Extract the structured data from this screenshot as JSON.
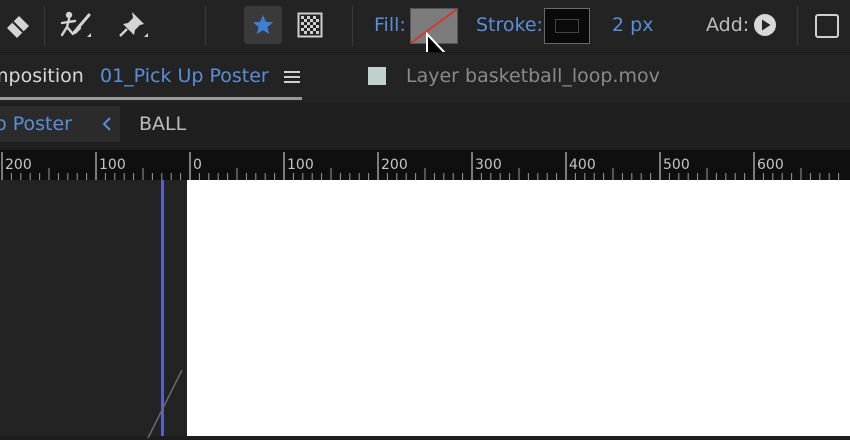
{
  "toolbar": {
    "tools": [
      {
        "name": "eraser"
      },
      {
        "name": "roto-brush"
      },
      {
        "name": "puppet-pin"
      }
    ],
    "fill_label": "Fill:",
    "stroke_label": "Stroke:",
    "stroke_width": "2 px",
    "add_label": "Add:",
    "accent": "#5a8fd8"
  },
  "tabs": {
    "composition_prefix": "mposition",
    "composition_name": "01_Pick Up Poster",
    "layer_label": "Layer basketball_loop.mov"
  },
  "breadcrumbs": {
    "current": "Jp Poster",
    "next": "BALL"
  },
  "ruler": {
    "labels": [
      "200",
      "100",
      "0",
      "100",
      "200",
      "300",
      "400",
      "500",
      "600"
    ]
  }
}
